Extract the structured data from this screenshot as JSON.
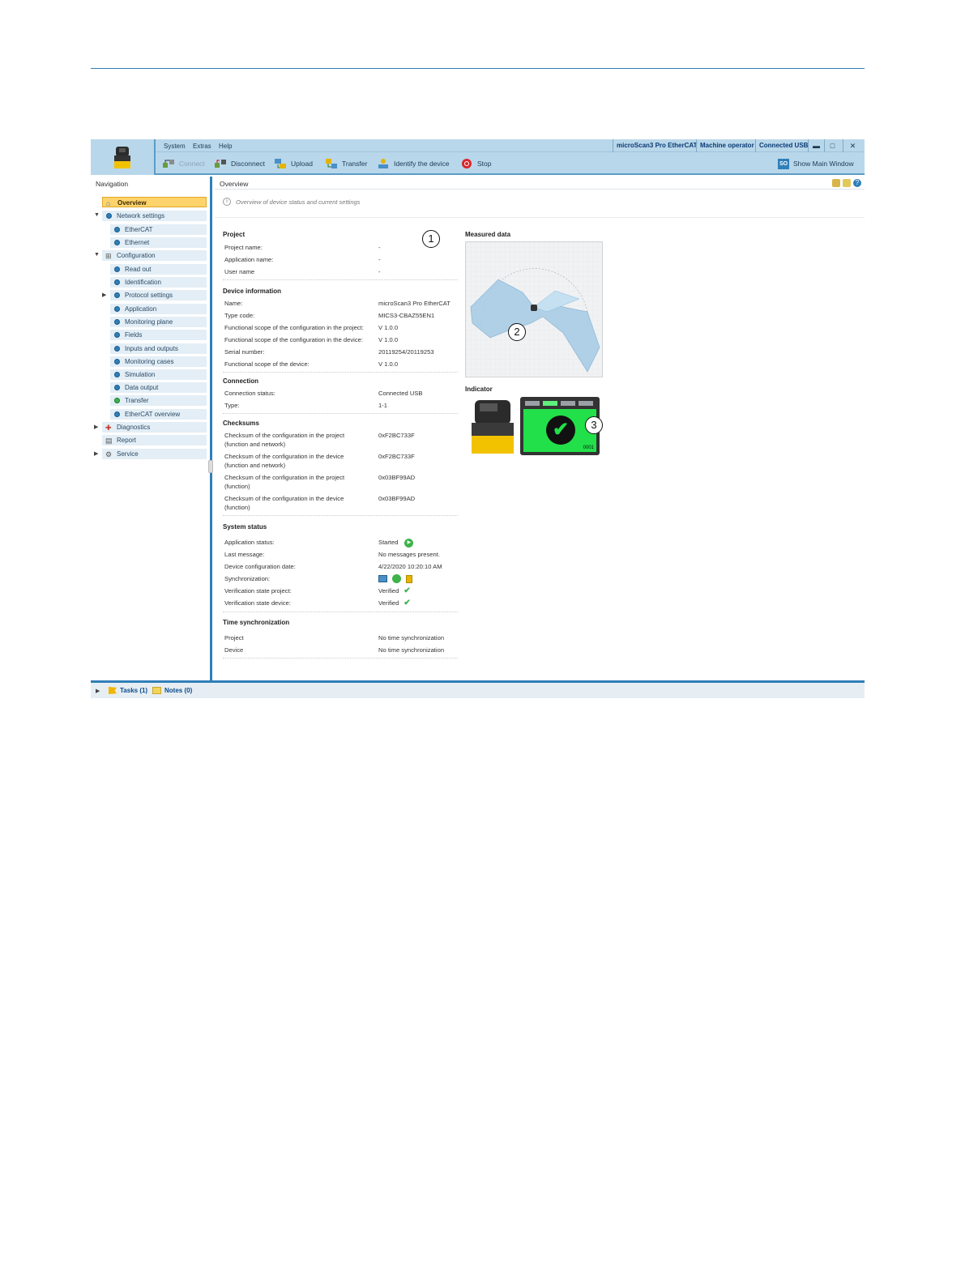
{
  "menu": {
    "system": "System",
    "extras": "Extras",
    "help": "Help"
  },
  "status": {
    "device": "microScan3 Pro EtherCAT",
    "user": "Machine operator",
    "connection": "Connected USB"
  },
  "window_buttons": {
    "minimize": "▬",
    "maximize": "□",
    "close": "✕"
  },
  "toolbar": {
    "connect": "Connect",
    "disconnect": "Disconnect",
    "upload": "Upload",
    "transfer": "Transfer",
    "identify": "Identify the device",
    "stop": "Stop",
    "show_main_badge": "SO",
    "show_main": "Show Main Window"
  },
  "navigation": {
    "title": "Navigation",
    "items": [
      {
        "label": "Overview"
      },
      {
        "label": "Network settings"
      },
      {
        "label": "EtherCAT"
      },
      {
        "label": "Ethernet"
      },
      {
        "label": "Configuration"
      },
      {
        "label": "Read out"
      },
      {
        "label": "Identification"
      },
      {
        "label": "Protocol settings"
      },
      {
        "label": "Application"
      },
      {
        "label": "Monitoring plane"
      },
      {
        "label": "Fields"
      },
      {
        "label": "Inputs and outputs"
      },
      {
        "label": "Monitoring cases"
      },
      {
        "label": "Simulation"
      },
      {
        "label": "Data output"
      },
      {
        "label": "Transfer"
      },
      {
        "label": "EtherCAT overview"
      },
      {
        "label": "Diagnostics"
      },
      {
        "label": "Report"
      },
      {
        "label": "Service"
      }
    ]
  },
  "overview": {
    "title": "Overview",
    "hint": "Overview of device status and current settings",
    "project": {
      "heading": "Project",
      "rows": [
        {
          "label": "Project name:",
          "value": "-"
        },
        {
          "label": "Application name:",
          "value": "-"
        },
        {
          "label": "User name",
          "value": "-"
        }
      ]
    },
    "device_info": {
      "heading": "Device information",
      "rows": [
        {
          "label": "Name:",
          "value": "microScan3 Pro EtherCAT"
        },
        {
          "label": "Type code:",
          "value": "MICS3-CBAZ55EN1"
        },
        {
          "label": "Functional scope of the configuration in the project:",
          "value": "V 1.0.0"
        },
        {
          "label": "Functional scope of the configuration in the device:",
          "value": "V 1.0.0"
        },
        {
          "label": "Serial number:",
          "value": "20119254/20119253"
        },
        {
          "label": "Functional scope of the device:",
          "value": "V 1.0.0"
        }
      ]
    },
    "connection": {
      "heading": "Connection",
      "rows": [
        {
          "label": "Connection status:",
          "value": "Connected USB"
        },
        {
          "label": "Type:",
          "value": "1-1"
        }
      ]
    },
    "checksums": {
      "heading": "Checksums",
      "rows": [
        {
          "label1": "Checksum of the configuration in the project",
          "label2": "(function and network)",
          "value": "0xF2BC733F"
        },
        {
          "label1": "Checksum of the configuration in the device",
          "label2": "(function and network)",
          "value": "0xF2BC733F"
        },
        {
          "label1": "Checksum of the configuration in the project",
          "label2": "(function)",
          "value": "0x03BF99AD"
        },
        {
          "label1": "Checksum of the configuration in the device",
          "label2": "(function)",
          "value": "0x03BF99AD"
        }
      ]
    },
    "system_status": {
      "heading": "System status",
      "rows": [
        {
          "label": "Application status:",
          "value": "Started"
        },
        {
          "label": "Last message:",
          "value": "No messages present."
        },
        {
          "label": "Device configuration date:",
          "value": "4/22/2020 10:20:10 AM"
        },
        {
          "label": "Synchronization:",
          "value": ""
        },
        {
          "label": "Verification state project:",
          "value": "Verified"
        },
        {
          "label": "Verification state device:",
          "value": "Verified"
        }
      ]
    },
    "time_sync": {
      "heading": "Time synchronization",
      "rows": [
        {
          "label": "Project",
          "value": "No time synchronization"
        },
        {
          "label": "Device",
          "value": "No time synchronization"
        }
      ]
    },
    "measured_data": {
      "heading": "Measured data"
    },
    "indicator": {
      "heading": "Indicator",
      "display_code": "0001"
    },
    "callouts": [
      "1",
      "2",
      "3"
    ]
  },
  "bottom_bar": {
    "tasks": "Tasks (1)",
    "notes": "Notes (0)"
  },
  "colors": {
    "accent": "#2f7fb8",
    "toolbar_bg": "#b9d7ea",
    "active_nav": "#ffd36b",
    "indicator_green": "#22e04a"
  }
}
